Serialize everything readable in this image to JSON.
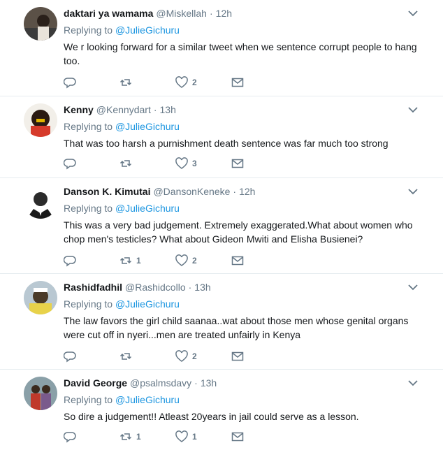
{
  "tweets": [
    {
      "name": "daktari ya wamama",
      "handle": "@Miskellah",
      "time": "12h",
      "replying_label": "Replying to",
      "replying_to": "@JulieGichuru",
      "text": "We r looking forward for a similar tweet when we sentence corrupt people to hang too.",
      "retweets": "",
      "likes": "2",
      "avatar_colors": [
        "#3b3b3b",
        "#6b5a4a"
      ]
    },
    {
      "name": "Kenny",
      "handle": "@Kennydart",
      "time": "13h",
      "replying_label": "Replying to",
      "replying_to": "@JulieGichuru",
      "text": "That was too harsh a purnishment  death sentence was far much too strong",
      "retweets": "",
      "likes": "3",
      "avatar_colors": [
        "#d63a2b",
        "#2a1a12"
      ]
    },
    {
      "name": "Danson K. Kimutai",
      "handle": "@DansonKeneke",
      "time": "12h",
      "replying_label": "Replying to",
      "replying_to": "@JulieGichuru",
      "text": "This was a very bad judgement. Extremely exaggerated.What about women who chop men's testicles? What about Gideon Mwiti and Elisha Busienei?",
      "retweets": "1",
      "likes": "2",
      "avatar_colors": [
        "#ffffff",
        "#1a1a1a"
      ]
    },
    {
      "name": "Rashidfadhil",
      "handle": "@Rashidcollo",
      "time": "13h",
      "replying_label": "Replying to",
      "replying_to": "@JulieGichuru",
      "text": "The law favors the girl child saanaa..wat about those men whose genital organs were cut off in nyeri...men are treated unfairly in Kenya",
      "retweets": "",
      "likes": "2",
      "avatar_colors": [
        "#e8d24a",
        "#4a3a28"
      ]
    },
    {
      "name": "David George",
      "handle": "@psalmsdavy",
      "time": "13h",
      "replying_label": "Replying to",
      "replying_to": "@JulieGichuru",
      "text": "So dire a judgement!! Atleast 20years in jail could serve as a lesson.",
      "retweets": "1",
      "likes": "1",
      "avatar_colors": [
        "#8aa0a8",
        "#c0392b"
      ]
    }
  ],
  "icons": {
    "reply": "reply-icon",
    "retweet": "retweet-icon",
    "like": "heart-icon",
    "dm": "envelope-icon",
    "menu": "chevron-down-icon"
  },
  "colors": {
    "link": "#1b95e0",
    "muted": "#657786",
    "divider": "#e6ecf0"
  }
}
